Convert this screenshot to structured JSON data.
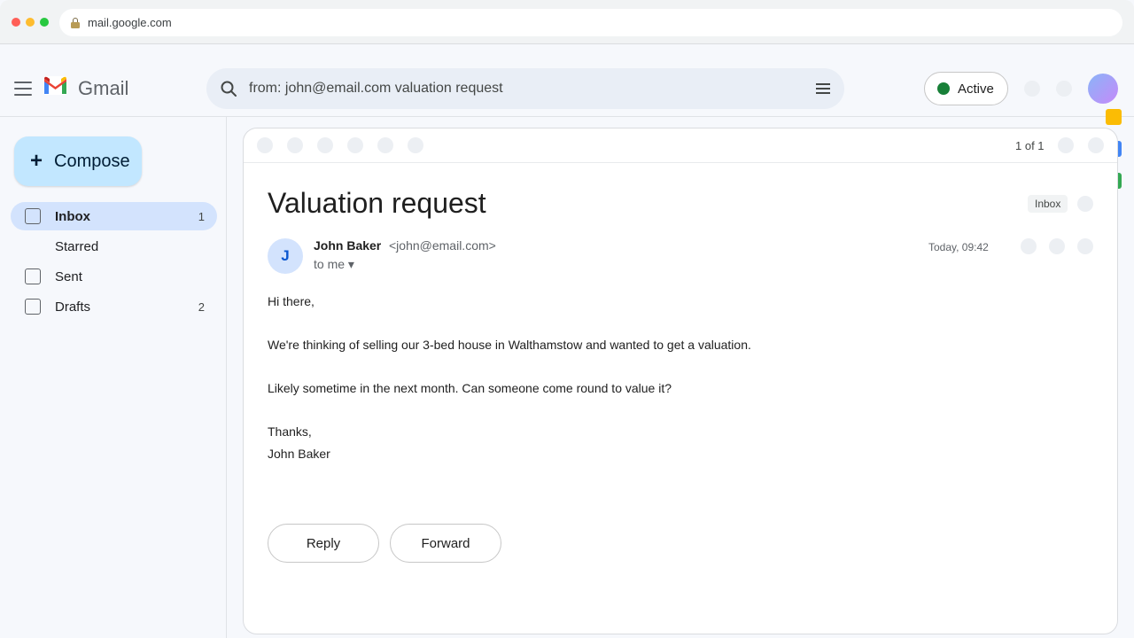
{
  "browser": {
    "url": "mail.google.com"
  },
  "header": {
    "app_name": "Gmail",
    "search_query": "from: john@email.com valuation request",
    "status_label": "Active",
    "status_color": "#188038"
  },
  "sidebar": {
    "compose_label": "Compose",
    "items": [
      {
        "label": "Inbox",
        "count": "1",
        "selected": true
      },
      {
        "label": "Starred",
        "count": ""
      },
      {
        "label": "Sent",
        "count": ""
      },
      {
        "label": "Drafts",
        "count": "2"
      }
    ]
  },
  "side_apps": [
    {
      "icon": "keep-icon",
      "color": "#fbbc04"
    },
    {
      "icon": "tasks-icon",
      "color": "#4285f4"
    },
    {
      "icon": "meet-icon",
      "color": "#34a853"
    }
  ],
  "toolbar": {
    "pager": "1 of 1"
  },
  "email": {
    "subject": "Valuation request",
    "label": "Inbox",
    "sender_initial": "J",
    "sender_name": "John Baker",
    "sender_email": "<john@email.com>",
    "recipient": "to me ▾",
    "timestamp": "Today, 09:42",
    "body": [
      "Hi there,",
      "We're thinking of selling our 3-bed house in Walthamstow and wanted to get a valuation.",
      "Likely sometime in the next month. Can someone come round to value it?",
      "Thanks,",
      "John Baker"
    ]
  },
  "actions": {
    "reply": "Reply",
    "forward": "Forward"
  }
}
